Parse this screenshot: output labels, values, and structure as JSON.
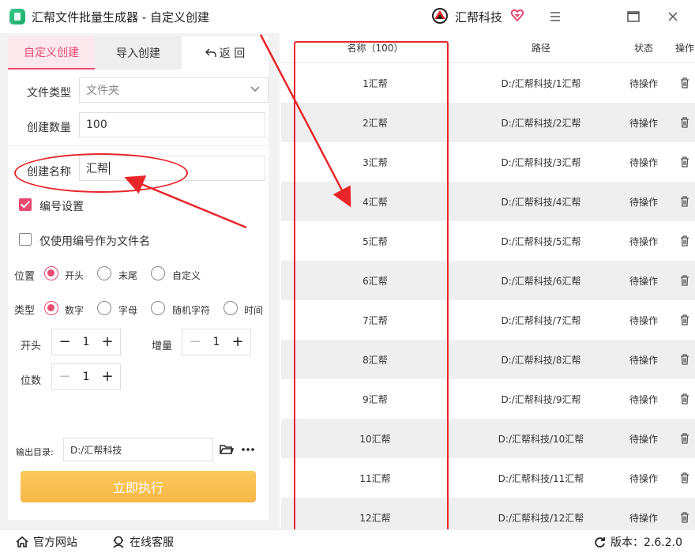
{
  "app": {
    "title": "汇帮文件批量生成器 - 自定义创建",
    "brand": "汇帮科技"
  },
  "tabs": {
    "custom": "自定义创建",
    "import": "导入创建",
    "back": "返 回"
  },
  "form": {
    "file_type_label": "文件类型",
    "file_type_value": "文件夹",
    "count_label": "创建数量",
    "count_value": "100",
    "name_label": "创建名称",
    "name_value": "汇帮",
    "numbering_label": "编号设置",
    "numbering_checked": true,
    "only_number_label": "仅使用编号作为文件名",
    "only_number_checked": false,
    "position_label": "位置",
    "position_options": [
      "开头",
      "末尾",
      "自定义"
    ],
    "position_selected": "开头",
    "type_label": "类型",
    "type_options": [
      "数字",
      "字母",
      "随机字符",
      "时间"
    ],
    "type_selected": "数字",
    "start_label": "开头",
    "start_value": "1",
    "increment_label": "增量",
    "increment_value": "1",
    "digits_label": "位数",
    "digits_value": "1",
    "output_label": "输出目录:",
    "output_value": "D:/汇帮科技",
    "run_label": "立即执行"
  },
  "table": {
    "headers": {
      "name": "名称（100）",
      "path": "路径",
      "state": "状态",
      "op": "操作"
    },
    "rows": [
      {
        "name": "1汇帮",
        "path": "D:/汇帮科技/1汇帮",
        "state": "待操作"
      },
      {
        "name": "2汇帮",
        "path": "D:/汇帮科技/2汇帮",
        "state": "待操作"
      },
      {
        "name": "3汇帮",
        "path": "D:/汇帮科技/3汇帮",
        "state": "待操作"
      },
      {
        "name": "4汇帮",
        "path": "D:/汇帮科技/4汇帮",
        "state": "待操作"
      },
      {
        "name": "5汇帮",
        "path": "D:/汇帮科技/5汇帮",
        "state": "待操作"
      },
      {
        "name": "6汇帮",
        "path": "D:/汇帮科技/6汇帮",
        "state": "待操作"
      },
      {
        "name": "7汇帮",
        "path": "D:/汇帮科技/7汇帮",
        "state": "待操作"
      },
      {
        "name": "8汇帮",
        "path": "D:/汇帮科技/8汇帮",
        "state": "待操作"
      },
      {
        "name": "9汇帮",
        "path": "D:/汇帮科技/9汇帮",
        "state": "待操作"
      },
      {
        "name": "10汇帮",
        "path": "D:/汇帮科技/10汇帮",
        "state": "待操作"
      },
      {
        "name": "11汇帮",
        "path": "D:/汇帮科技/11汇帮",
        "state": "待操作"
      },
      {
        "name": "12汇帮",
        "path": "D:/汇帮科技/12汇帮",
        "state": "待操作"
      }
    ]
  },
  "status": {
    "website": "官方网站",
    "support": "在线客服",
    "version": "版本：2.6.2.0"
  },
  "colors": {
    "accent": "#e84a72",
    "annotation": "#e8262a",
    "run_button": "#f6b84a"
  },
  "icons": [
    "app-icon",
    "brand-logo-icon",
    "heart-icon",
    "menu-icon",
    "maximize-icon",
    "close-icon",
    "back-icon",
    "chevron-down-icon",
    "folder-icon",
    "more-icon",
    "trash-icon",
    "home-icon",
    "support-icon",
    "refresh-icon"
  ]
}
